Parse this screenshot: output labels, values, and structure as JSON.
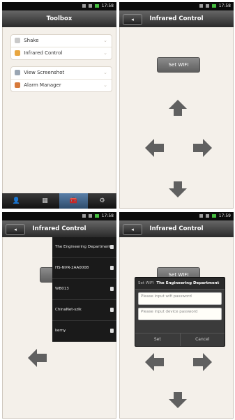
{
  "status_time": "17:58",
  "status_time_alt": "17:59",
  "toolbox": {
    "title": "Toolbox",
    "group1": [
      {
        "label": "Shake",
        "icon": "shake-icon"
      },
      {
        "label": "Infrared Control",
        "icon": "infrared-icon"
      }
    ],
    "group2": [
      {
        "label": "View Screenshot",
        "icon": "screenshot-icon"
      },
      {
        "label": "Alarm Manager",
        "icon": "alarm-icon"
      }
    ],
    "nav_tabs": [
      {
        "icon": "person-icon",
        "glyph": "👤"
      },
      {
        "icon": "grid-icon",
        "glyph": "▦"
      },
      {
        "icon": "toolbox-icon",
        "glyph": "🧰"
      },
      {
        "icon": "settings-gear-icon",
        "glyph": "⚙"
      }
    ]
  },
  "infrared": {
    "title": "Infrared Control",
    "set_wifi_label": "Set WIFI",
    "back_label": "◂"
  },
  "wifi_networks": [
    {
      "ssid": "The Engineering Department"
    },
    {
      "ssid": "HS-NVR-2AA0008"
    },
    {
      "ssid": "WB013"
    },
    {
      "ssid": "ChinaNet-szlk"
    },
    {
      "ssid": "kerny"
    }
  ],
  "dialog": {
    "title_prefix": "Set WIFI",
    "title_network": "The Engineering Department",
    "wifi_password_placeholder": "Please input wifi password",
    "device_password_placeholder": "Please input device password",
    "set_label": "Set",
    "cancel_label": "Cancel"
  },
  "colors": {
    "accent_blue": "#3f6a94",
    "battery_green": "#47c041",
    "titlebar_dark": "#2a2a2a"
  }
}
